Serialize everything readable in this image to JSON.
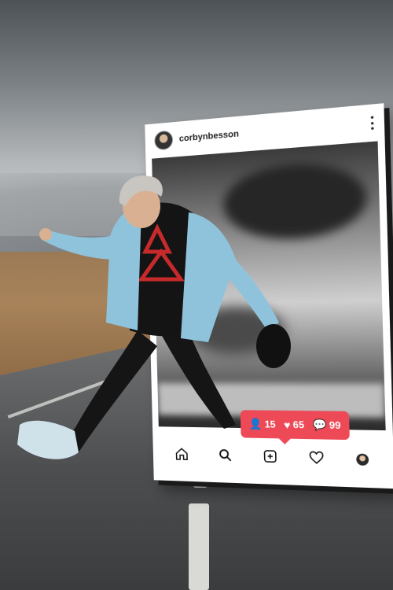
{
  "post": {
    "username": "corbynbesson"
  },
  "notification": {
    "followers": "15",
    "likes": "65",
    "comments": "99"
  },
  "nav": {
    "icons": [
      "home-icon",
      "search-icon",
      "new-post-icon",
      "heart-icon",
      "profile-avatar"
    ]
  },
  "colors": {
    "notification_red": "#ed4956",
    "jacket": "#8fc3dc",
    "road": "#4c4e50"
  }
}
